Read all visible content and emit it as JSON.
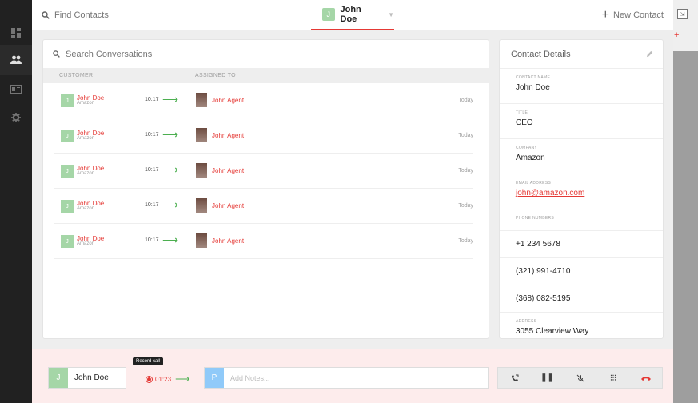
{
  "topbar": {
    "find_placeholder": "Find Contacts",
    "active_contact": {
      "initial": "J",
      "name": "John Doe"
    },
    "new_contact_label": "New Contact"
  },
  "conversations": {
    "search_placeholder": "Search Conversations",
    "columns": {
      "customer": "CUSTOMER",
      "assigned_to": "ASSIGNED TO"
    },
    "rows": [
      {
        "initial": "J",
        "name": "John Doe",
        "company": "Amazon",
        "time": "10:17",
        "agent": "John Agent",
        "date": "Today"
      },
      {
        "initial": "J",
        "name": "John Doe",
        "company": "Amazon",
        "time": "10:17",
        "agent": "John Agent",
        "date": "Today"
      },
      {
        "initial": "J",
        "name": "John Doe",
        "company": "Amazon",
        "time": "10:17",
        "agent": "John Agent",
        "date": "Today"
      },
      {
        "initial": "J",
        "name": "John Doe",
        "company": "Amazon",
        "time": "10:17",
        "agent": "John Agent",
        "date": "Today"
      },
      {
        "initial": "J",
        "name": "John Doe",
        "company": "Amazon",
        "time": "10:17",
        "agent": "John Agent",
        "date": "Today"
      }
    ]
  },
  "details": {
    "title": "Contact Details",
    "contact_name": {
      "label": "CONTACT NAME",
      "value": "John Doe"
    },
    "title_field": {
      "label": "TITLE",
      "value": "CEO"
    },
    "company": {
      "label": "COMPANY",
      "value": "Amazon"
    },
    "email": {
      "label": "EMAIL ADDRESS",
      "value": "john@amazon.com"
    },
    "phones_label": "PHONE NUMBERS",
    "phones": [
      "+1 234 5678",
      "(321) 991-4710",
      "(368) 082-5195"
    ],
    "address": {
      "label": "ADDRESS",
      "value": "3055 Clearview Way"
    }
  },
  "callbar": {
    "caller": {
      "initial": "J",
      "name": "John Doe"
    },
    "tooltip": "Record call",
    "duration": "01:23",
    "notes_initial": "P",
    "notes_placeholder": "Add Notes..."
  },
  "colors": {
    "accent": "#e53935",
    "success": "#4caf50",
    "avatar_green": "#a5d6a7",
    "avatar_blue": "#90caf9"
  }
}
